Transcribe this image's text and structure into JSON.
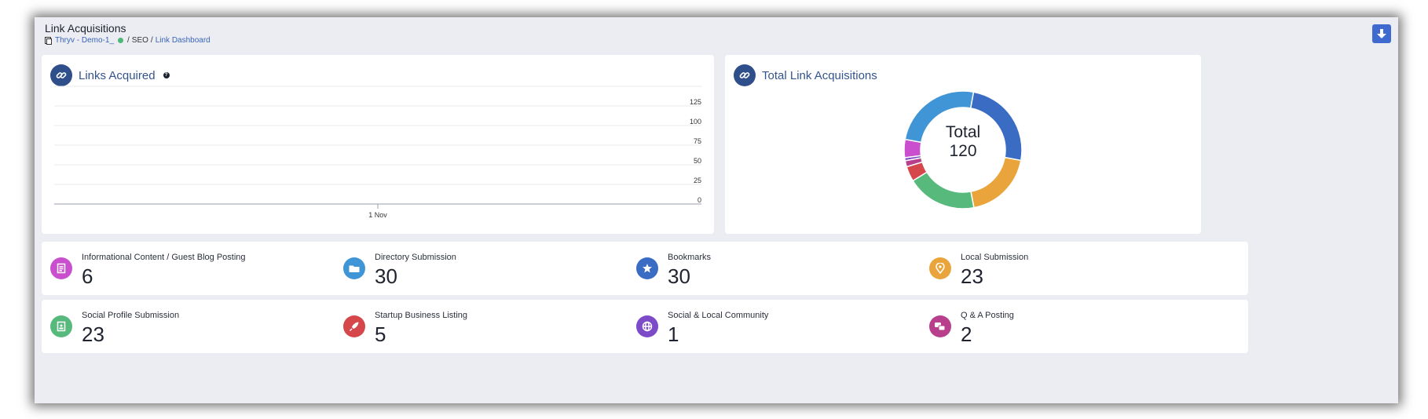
{
  "header": {
    "title": "Link Acquisitions",
    "breadcrumb": {
      "client": "Thryv - Demo-1_",
      "section": "SEO",
      "page": "Link Dashboard",
      "separator": "/"
    }
  },
  "links_acquired": {
    "title": "Links Acquired",
    "help": "?"
  },
  "total_links": {
    "title": "Total Link Acquisitions",
    "center_label": "Total",
    "center_value": "120"
  },
  "stats": [
    {
      "label": "Informational Content / Guest Blog Posting",
      "value": "6",
      "color": "#c94fce",
      "icon": "document-icon"
    },
    {
      "label": "Directory Submission",
      "value": "30",
      "color": "#3f95d6",
      "icon": "folder-icon"
    },
    {
      "label": "Bookmarks",
      "value": "30",
      "color": "#3b6cc4",
      "icon": "star-bookmark-icon"
    },
    {
      "label": "Local Submission",
      "value": "23",
      "color": "#e9a53b",
      "icon": "map-pin-icon"
    },
    {
      "label": "Social Profile Submission",
      "value": "23",
      "color": "#57b97c",
      "icon": "profile-document-icon"
    },
    {
      "label": "Startup Business Listing",
      "value": "5",
      "color": "#d5474b",
      "icon": "rocket-icon"
    },
    {
      "label": "Social & Local Community",
      "value": "1",
      "color": "#7d4bc7",
      "icon": "globe-icon"
    },
    {
      "label": "Q & A Posting",
      "value": "2",
      "color": "#b73f8c",
      "icon": "chat-bubbles-icon"
    }
  ],
  "chart_data": [
    {
      "type": "line",
      "title": "Links Acquired",
      "x": [
        "1 Nov"
      ],
      "y_ticks": [
        0,
        25,
        50,
        75,
        100,
        125
      ],
      "ylim": [
        0,
        150
      ],
      "y_axis_position": "right",
      "grid": true,
      "series": []
    },
    {
      "type": "pie",
      "title": "Total Link Acquisitions",
      "donut": true,
      "total": 120,
      "slices": [
        {
          "label": "Bookmarks",
          "value": 30,
          "color": "#3b6cc4"
        },
        {
          "label": "Local Submission",
          "value": 23,
          "color": "#e9a53b"
        },
        {
          "label": "Social Profile Submission",
          "value": 23,
          "color": "#57b97c"
        },
        {
          "label": "Startup Business Listing",
          "value": 5,
          "color": "#d5474b"
        },
        {
          "label": "Q & A Posting",
          "value": 2,
          "color": "#b73f8c"
        },
        {
          "label": "Social & Local Community",
          "value": 1,
          "color": "#7d4bc7"
        },
        {
          "label": "Informational Content / Guest Blog Posting",
          "value": 6,
          "color": "#c94fce"
        },
        {
          "label": "Directory Submission",
          "value": 30,
          "color": "#3f95d6"
        }
      ]
    }
  ]
}
